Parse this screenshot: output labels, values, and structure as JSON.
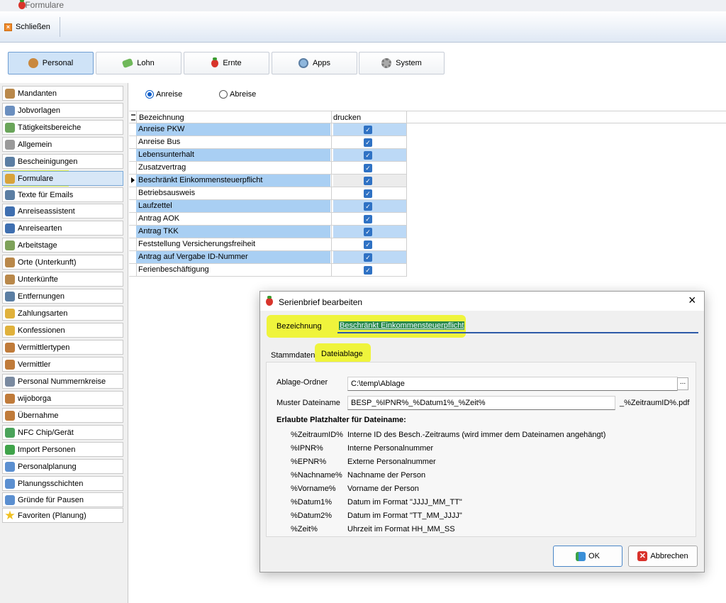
{
  "window": {
    "title": "Formulare"
  },
  "toolbar": {
    "close_label": "Schließen"
  },
  "main_tabs": [
    {
      "label": "Personal",
      "icon": "people-icon",
      "active": true
    },
    {
      "label": "Lohn",
      "icon": "money-icon"
    },
    {
      "label": "Ernte",
      "icon": "strawberry-icon"
    },
    {
      "label": "Apps",
      "icon": "apps-icon"
    },
    {
      "label": "System",
      "icon": "gear-icon"
    }
  ],
  "sidebar": {
    "items": [
      {
        "label": "Mandanten",
        "icon": "house-icon"
      },
      {
        "label": "Jobvorlagen",
        "icon": "globe-icon"
      },
      {
        "label": "Tätigkeitsbereiche",
        "icon": "chart-icon"
      },
      {
        "label": "Allgemein",
        "icon": "gear-icon"
      },
      {
        "label": "Bescheinigungen",
        "icon": "list-icon"
      },
      {
        "label": "Formulare",
        "icon": "printer-icon",
        "active": true
      },
      {
        "label": "Texte für Emails",
        "icon": "text-icon"
      },
      {
        "label": "Anreiseassistent",
        "icon": "car-icon"
      },
      {
        "label": "Anreisearten",
        "icon": "car-icon"
      },
      {
        "label": "Arbeitstage",
        "icon": "clock-icon"
      },
      {
        "label": "Orte (Unterkunft)",
        "icon": "house-icon"
      },
      {
        "label": "Unterkünfte",
        "icon": "house-icon"
      },
      {
        "label": "Entfernungen",
        "icon": "ruler-icon"
      },
      {
        "label": "Zahlungsarten",
        "icon": "coins-icon"
      },
      {
        "label": "Konfessionen",
        "icon": "coins-icon"
      },
      {
        "label": "Vermittlertypen",
        "icon": "person-icon"
      },
      {
        "label": "Vermittler",
        "icon": "person-icon"
      },
      {
        "label": "Personal Nummernkreise",
        "icon": "document-icon"
      },
      {
        "label": "wijoborga",
        "icon": "person-icon"
      },
      {
        "label": "Übernahme",
        "icon": "person-icon"
      },
      {
        "label": "NFC Chip/Gerät",
        "icon": "nfc-icon"
      },
      {
        "label": "Import Personen",
        "icon": "refresh-icon"
      },
      {
        "label": "Personalplanung",
        "icon": "bar-chart-icon"
      },
      {
        "label": "Planungsschichten",
        "icon": "bar-chart-icon"
      },
      {
        "label": "Gründe für Pausen",
        "icon": "bar-chart-icon"
      },
      {
        "label": "Favoriten (Planung)",
        "icon": "star-icon"
      }
    ]
  },
  "radio": {
    "anreise": "Anreise",
    "abreise": "Abreise",
    "selected": "Anreise"
  },
  "grid": {
    "headers": {
      "bezeichnung": "Bezeichnung",
      "drucken": "drucken"
    },
    "rows": [
      {
        "name": "Anreise PKW",
        "checked": true
      },
      {
        "name": "Anreise Bus",
        "checked": true
      },
      {
        "name": "Lebensunterhalt",
        "checked": true
      },
      {
        "name": "Zusatzvertrag",
        "checked": true
      },
      {
        "name": "Beschränkt Einkommensteuerpflicht",
        "checked": true
      },
      {
        "name": "Betriebsausweis",
        "checked": true
      },
      {
        "name": "Laufzettel",
        "checked": true
      },
      {
        "name": "Antrag AOK",
        "checked": true
      },
      {
        "name": "Antrag TKK",
        "checked": true
      },
      {
        "name": "Feststellung Versicherungsfreiheit",
        "checked": true
      },
      {
        "name": "Antrag auf Vergabe ID-Nummer",
        "checked": true
      },
      {
        "name": "Ferienbeschäftigung",
        "checked": true
      }
    ]
  },
  "dialog": {
    "title": "Serienbrief bearbeiten",
    "bezeichnung_label": "Bezeichnung",
    "bezeichnung_value": "Beschränkt Einkommensteuerpflicht",
    "tabs": [
      "Stammdaten",
      "Dateiablage"
    ],
    "active_tab": "Dateiablage",
    "ablage_label": "Ablage-Ordner",
    "ablage_value": "C:\\temp\\Ablage",
    "browse_label": "...",
    "muster_label": "Muster Dateiname",
    "muster_value": "BESP_%IPNR%_%Datum1%_%Zeit%",
    "muster_suffix": "_%ZeitraumID%.pdf",
    "placeholders_title": "Erlaubte Platzhalter für Dateiname:",
    "placeholders": [
      {
        "key": "%ZeitraumID%",
        "desc": "Interne ID des Besch.-Zeitraums (wird immer dem Dateinamen angehängt)"
      },
      {
        "key": "%IPNR%",
        "desc": "Interne Personalnummer"
      },
      {
        "key": "%EPNR%",
        "desc": "Externe Personalnummer"
      },
      {
        "key": "%Nachname%",
        "desc": "Nachname der Person"
      },
      {
        "key": "%Vorname%",
        "desc": "Vorname der Person"
      },
      {
        "key": "%Datum1%",
        "desc": "Datum im Format \"JJJJ_MM_TT\""
      },
      {
        "key": "%Datum2%",
        "desc": "Datum im Format \"TT_MM_JJJJ\""
      },
      {
        "key": "%Zeit%",
        "desc": "Uhrzeit im Format HH_MM_SS"
      }
    ],
    "ok_label": "OK",
    "cancel_label": "Abbrechen"
  }
}
